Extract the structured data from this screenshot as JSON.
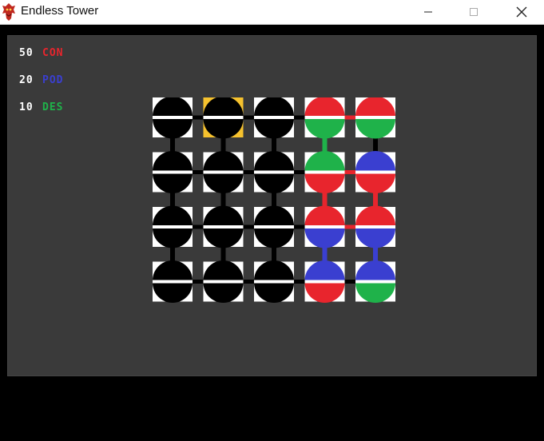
{
  "window": {
    "title": "Endless Tower",
    "icon": "dragon-icon"
  },
  "stats": [
    {
      "value": "50",
      "name": "CON",
      "color": "#e8252d"
    },
    {
      "value": "20",
      "name": "POD",
      "color": "#3a3fd0"
    },
    {
      "value": "10",
      "name": "DES",
      "color": "#1fb24a"
    }
  ],
  "board": {
    "rows": 4,
    "cols": 5,
    "colors": {
      "black": "#000000",
      "red": "#e8252d",
      "green": "#1fb24a",
      "blue": "#3a3fd0",
      "cell_bg": "#ffffff",
      "selected_bg": "#f6c22e",
      "panel_bg": "#3a3a3a"
    },
    "cells": [
      [
        {
          "top": "black",
          "bottom": "black"
        },
        {
          "top": "black",
          "bottom": "black",
          "selected": true
        },
        {
          "top": "black",
          "bottom": "black"
        },
        {
          "top": "red",
          "bottom": "green"
        },
        {
          "top": "red",
          "bottom": "green"
        }
      ],
      [
        {
          "top": "black",
          "bottom": "black"
        },
        {
          "top": "black",
          "bottom": "black"
        },
        {
          "top": "black",
          "bottom": "black"
        },
        {
          "top": "green",
          "bottom": "red"
        },
        {
          "top": "blue",
          "bottom": "red"
        }
      ],
      [
        {
          "top": "black",
          "bottom": "black"
        },
        {
          "top": "black",
          "bottom": "black"
        },
        {
          "top": "black",
          "bottom": "black"
        },
        {
          "top": "red",
          "bottom": "blue"
        },
        {
          "top": "red",
          "bottom": "blue"
        }
      ],
      [
        {
          "top": "black",
          "bottom": "black"
        },
        {
          "top": "black",
          "bottom": "black"
        },
        {
          "top": "black",
          "bottom": "black"
        },
        {
          "top": "blue",
          "bottom": "red"
        },
        {
          "top": "blue",
          "bottom": "green"
        }
      ]
    ],
    "h_links": [
      [
        "black",
        "black",
        "black",
        "red"
      ],
      [
        "black",
        "black",
        "black",
        "red"
      ],
      [
        "black",
        "black",
        "black",
        "red"
      ],
      [
        "black",
        "black",
        "black",
        "black"
      ]
    ],
    "v_links": [
      [
        "black",
        "black",
        "black",
        "green",
        "black"
      ],
      [
        "black",
        "black",
        "black",
        "red",
        "red"
      ],
      [
        "black",
        "black",
        "black",
        "blue",
        "blue"
      ]
    ]
  }
}
